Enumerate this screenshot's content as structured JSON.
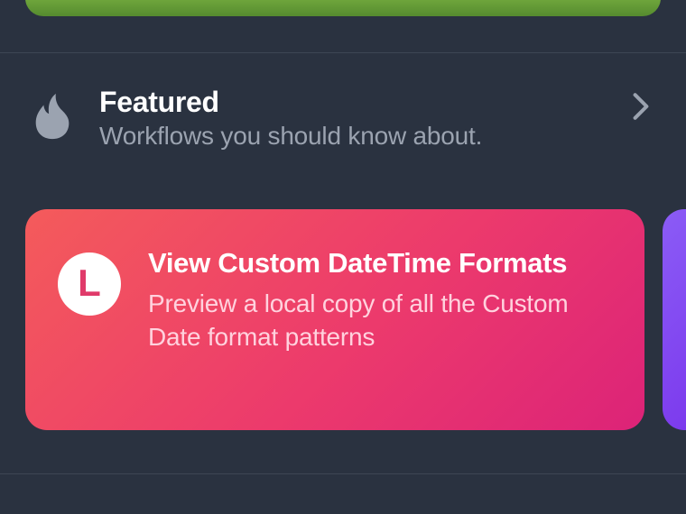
{
  "section": {
    "title": "Featured",
    "subtitle": "Workflows you should know about.",
    "icon": "fire-icon"
  },
  "card": {
    "icon": "clock-icon",
    "glyph": "L",
    "title": "View Custom DateTime Formats",
    "subtitle": "Preview a local copy of all the Custom Date format patterns",
    "gradient_start": "#f45b5b",
    "gradient_end": "#dc2378"
  }
}
